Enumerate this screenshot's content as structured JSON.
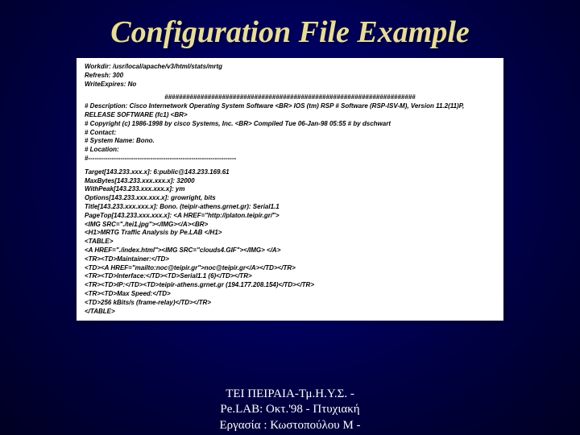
{
  "title": "Configuration File Example",
  "config": {
    "l1": "Workdir: /usr/local/apache/v3/html/stats/mrtg",
    "l2": "Refresh: 300",
    "l3": "WriteExpires: No",
    "l4": "######################################################################",
    "l5": "# Description: Cisco Internetwork Operating System Software <BR> IOS (tm) RSP # Software (RSP-ISV-M), Version 11.2(11)P, RELEASE SOFTWARE (fc1) <BR>",
    "l6": "# Copyright (c) 1986-1998 by cisco Systems, Inc. <BR> Compiled Tue 06-Jan-98 05:55 # by dschwart",
    "l7": "#  Contact:",
    "l8": "#  System Name: Bono.",
    "l9": "#  Location:",
    "l10": "#---------------------------------------------------------------------",
    "l11": "Target[143.233.xxx.x]: 6:public@143.233.169.61",
    "l12": "MaxBytes[143.233.xxx.xxx.x]: 32000",
    "l13": "WithPeak[143.233.xxx.xxx.x]: ym",
    "l14": "Options[143.233.xxx.xxx.x]: growright, bits",
    "l15": "Title[143.233.xxx.xxx.x]: Bono. (teipir-athens.grnet.gr): Serial1.1",
    "l16": "PageTop[143.233.xxx.xxx.x]: <A HREF=\"http://platon.teipir.gr/\">",
    "l17": "<IMG SRC=\"./tei1.jpg\"></IMG></A><BR>",
    "l18": "<H1>MRTG Traffic Analysis by Pe.LAB </H1>",
    "l19": "<TABLE>",
    "l20": "<A HREF=\"./index.html\"><IMG SRC=\"clouds4.GIF\"></IMG> </A>",
    "l21": "<TR><TD>Maintainer:</TD>",
    "l22": "<TD><A HREF=\"mailto:noc@teipir.gr\">noc@teipir.gr</A></TD></TR>",
    "l23": "<TR><TD>Interface:</TD><TD>Serial1.1 (6)</TD></TR>",
    "l24": "<TR><TD>IP:</TD><TD>teipir-athens.grnet.gr (194.177.208.154)</TD></TR>",
    "l25": "<TR><TD>Max Speed:</TD>",
    "l26": "<TD>256 kBits/s (frame-relay)</TD></TR>",
    "l27": "</TABLE>"
  },
  "footer": {
    "line1": "ΤΕΙ ΠΕΙΡΑΙΑ-Τμ.Η.Υ.Σ. -",
    "line2": "Pe.LAB: Οκτ.'98    -    Πτυχιακή",
    "line3": "Εργασία : Κωστοπούλου Μ  -"
  }
}
